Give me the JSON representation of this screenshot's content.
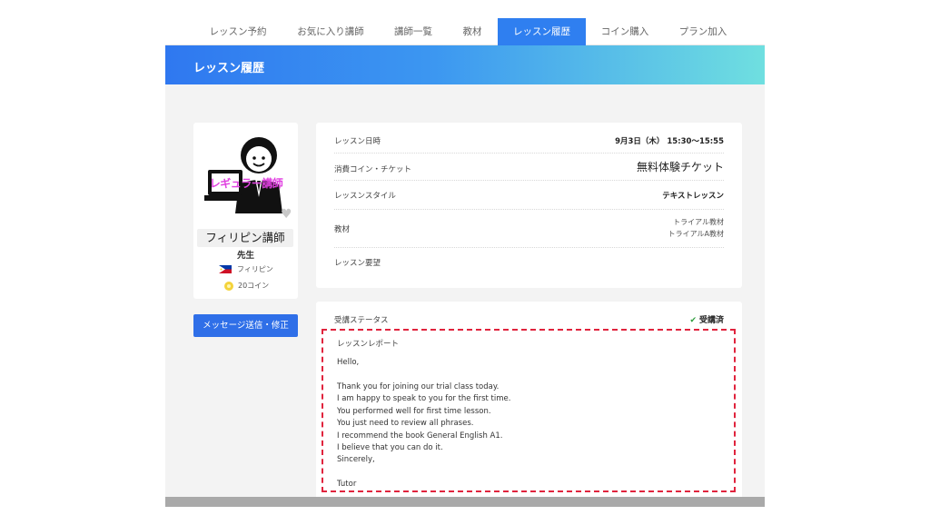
{
  "nav": {
    "tabs": [
      {
        "label": "レッスン予約"
      },
      {
        "label": "お気に入り講師"
      },
      {
        "label": "講師一覧"
      },
      {
        "label": "教材"
      },
      {
        "label": "レッスン履歴"
      },
      {
        "label": "コイン購入"
      },
      {
        "label": "プラン加入"
      }
    ],
    "active_tab": "レッスン履歴"
  },
  "banner": {
    "title": "レッスン履歴"
  },
  "profile": {
    "badge_text": "レギュラー講師",
    "name": "フィリピン講師",
    "title": "先生",
    "country": "フィリピン",
    "coins": "20コイン",
    "favorite_icon": "heart-icon",
    "message_button": "メッセージ送信・修正"
  },
  "details": {
    "rows": [
      {
        "label": "レッスン日時",
        "value": "9月3日（木） 15:30〜15:55"
      },
      {
        "label": "消費コイン・チケット",
        "value": "無料体験チケット"
      },
      {
        "label": "レッスンスタイル",
        "value": "テキストレッスン"
      },
      {
        "label": "教材",
        "value_lines": [
          "トライアル教材",
          "トライアルA教材"
        ]
      },
      {
        "label": "レッスン要望",
        "value": ""
      }
    ]
  },
  "status": {
    "label": "受講ステータス",
    "value": "受講済",
    "icon": "check-icon",
    "status_color": "#2e9e3e"
  },
  "report": {
    "title": "レッスンレポート",
    "greeting": "Hello,",
    "body": [
      "Thank you for joining our trial class today.",
      "I am happy to speak to you for the first time.",
      "You performed well for first time lesson.",
      "You just need to review all phrases.",
      "I recommend the book General English A1.",
      "I believe that you can do it."
    ],
    "closing": "Sincerely,",
    "signature": "Tutor"
  },
  "colors": {
    "accent": "#2f7ff0",
    "button": "#2f6fe8",
    "highlight_border": "#e0233d"
  }
}
